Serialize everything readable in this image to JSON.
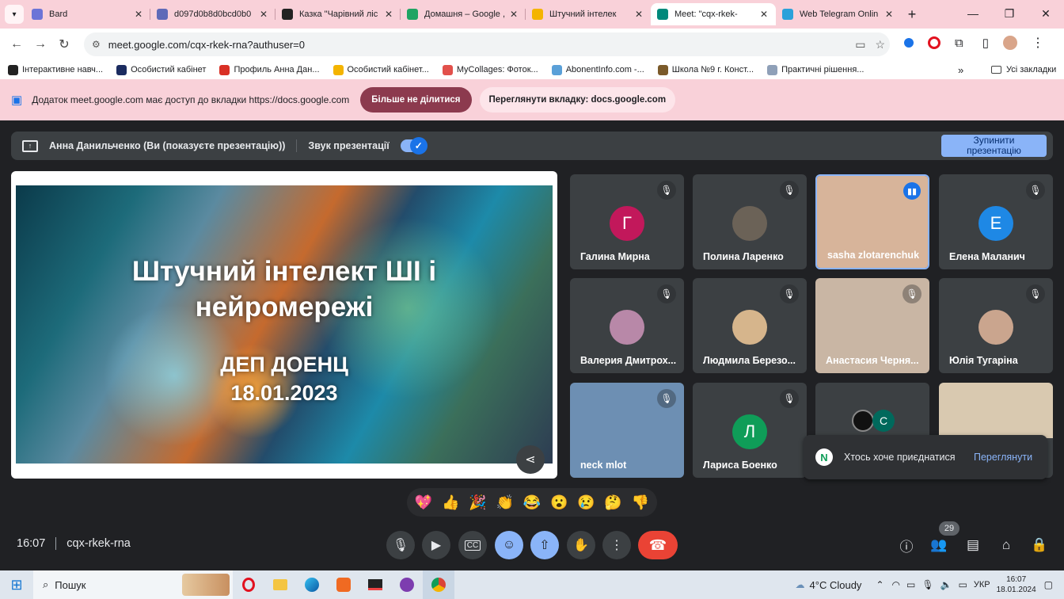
{
  "browser": {
    "tabs": [
      {
        "title": "Bard",
        "icon": "bard-icon",
        "color": "#6c74d7"
      },
      {
        "title": "d097d0b8d0bcd0b0",
        "icon": "search-icon",
        "color": "#5f6ab8"
      },
      {
        "title": "Казка \"Чарівний ліс",
        "icon": "story-icon",
        "color": "#222"
      },
      {
        "title": "Домашня – Google ,",
        "icon": "drive-icon",
        "color": "#1fa463"
      },
      {
        "title": "Штучний інтелек",
        "icon": "slides-icon",
        "color": "#f4b400"
      },
      {
        "title": "Meet: \"cqx-rkek-",
        "icon": "meet-icon",
        "color": "#00897b"
      },
      {
        "title": "Web Telegram Onlin",
        "icon": "telegram-icon",
        "color": "#2aa1da"
      }
    ],
    "url": "meet.google.com/cqx-rkek-rna?authuser=0",
    "bookmarks": [
      {
        "label": "Інтерактивне навч...",
        "color": "#222"
      },
      {
        "label": "Особистий кабінет",
        "color": "#1b2c60"
      },
      {
        "label": "Профиль Анна Дан...",
        "color": "#d93025"
      },
      {
        "label": "Особистий кабінет...",
        "color": "#f4b400"
      },
      {
        "label": "MyCollages: Фоток...",
        "color": "#e2504b"
      },
      {
        "label": "AbonentInfo.com -...",
        "color": "#5aa0d8"
      },
      {
        "label": "Школа №9 г. Конст...",
        "color": "#7b5a2a"
      },
      {
        "label": "Практичні рішення...",
        "color": "#8fa0b8"
      }
    ],
    "all_bookmarks": "Усі закладки"
  },
  "infobar": {
    "message": "Додаток meet.google.com має доступ до вкладки https://docs.google.com",
    "stop_sharing": "Більше не ділитися",
    "view_tab": "Переглянути вкладку: docs.google.com"
  },
  "presenting": {
    "label": "Анна Данильченко (Ви (показуєте презентацію))",
    "audio_label": "Звук презентації",
    "stop_line1": "Зупинити",
    "stop_line2": "презентацію"
  },
  "slide": {
    "title_line1": "Штучний інтелект ШІ і",
    "title_line2": "нейромережі",
    "org": "ДЕП ДОЕНЦ",
    "date": "18.01.2023"
  },
  "participants": [
    {
      "name": "Галина Мирна",
      "initial": "Г",
      "color": "#c2185b"
    },
    {
      "name": "Полина Ларенко",
      "initial": "",
      "color": "#6b6257"
    },
    {
      "name": "sasha zlotarenchuk",
      "initial": "",
      "color": "#d7b49a"
    },
    {
      "name": "Елена Маланич",
      "initial": "Е",
      "color": "#1e88e5"
    },
    {
      "name": "Валерия Дмитрох...",
      "initial": "",
      "color": "#b888a8"
    },
    {
      "name": "Людмила Березо...",
      "initial": "",
      "color": "#d6b58c"
    },
    {
      "name": "Анастасия Черня...",
      "initial": "",
      "color": "#c9b6a4"
    },
    {
      "name": "Юлія Тугаріна",
      "initial": "",
      "color": "#caa58e"
    },
    {
      "name": "neck mlot",
      "initial": "",
      "color": "#6d8fb3"
    },
    {
      "name": "Лариса Боенко",
      "initial": "Л",
      "color": "#0f9d58"
    },
    {
      "name": "",
      "initial": "С",
      "color": "#00695c"
    },
    {
      "name": "",
      "initial": "",
      "color": "#d9c9b0"
    }
  ],
  "toast": {
    "initial": "N",
    "message": "Хтось хоче приєднатися",
    "action": "Переглянути"
  },
  "reactions": [
    "💖",
    "👍",
    "🎉",
    "👏",
    "😂",
    "😮",
    "😢",
    "🤔",
    "👎"
  ],
  "controls": {
    "time": "16:07",
    "meeting_code": "cqx-rkek-rna",
    "participant_count": "29"
  },
  "taskbar": {
    "search_placeholder": "Пошук",
    "weather": "4°C Cloudy",
    "language": "УКР",
    "time": "16:07",
    "date": "18.01.2024"
  }
}
